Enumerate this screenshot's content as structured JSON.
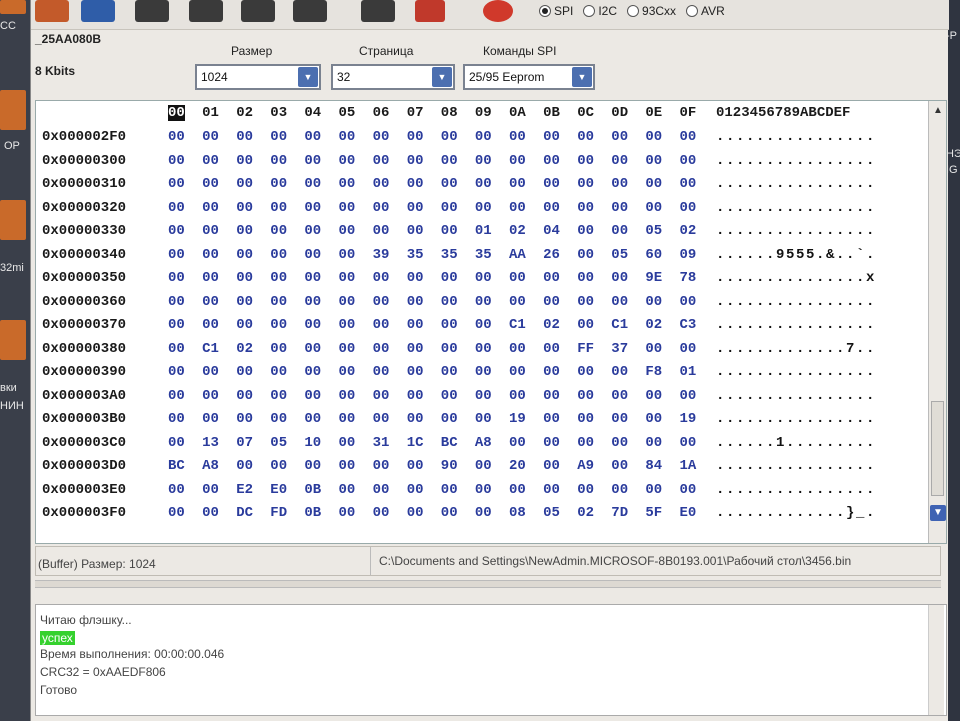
{
  "desktop": {
    "labels": [
      "CC",
      "OP",
      "32mi",
      "вки",
      "НИН"
    ],
    "right_labels": [
      "-P",
      "НЭ",
      "IG"
    ]
  },
  "toolbar": {
    "protocols": [
      "SPI",
      "I2C",
      "93Cxx",
      "AVR"
    ],
    "selected": "SPI"
  },
  "chip": {
    "name": "_25AA080B",
    "size": "8 Kbits"
  },
  "settings": {
    "size_label": "Размер",
    "size_value": "1024",
    "page_label": "Страница",
    "page_value": "32",
    "cmd_label": "Команды SPI",
    "cmd_value": "25/95 Eeprom"
  },
  "hex": {
    "columns": [
      "00",
      "01",
      "02",
      "03",
      "04",
      "05",
      "06",
      "07",
      "08",
      "09",
      "0A",
      "0B",
      "0C",
      "0D",
      "0E",
      "0F"
    ],
    "ascii_header": "0123456789ABCDEF",
    "rows": [
      {
        "addr": "0x000002F0",
        "bytes": [
          "00",
          "00",
          "00",
          "00",
          "00",
          "00",
          "00",
          "00",
          "00",
          "00",
          "00",
          "00",
          "00",
          "00",
          "00",
          "00"
        ],
        "ascii": "................"
      },
      {
        "addr": "0x00000300",
        "bytes": [
          "00",
          "00",
          "00",
          "00",
          "00",
          "00",
          "00",
          "00",
          "00",
          "00",
          "00",
          "00",
          "00",
          "00",
          "00",
          "00"
        ],
        "ascii": "................"
      },
      {
        "addr": "0x00000310",
        "bytes": [
          "00",
          "00",
          "00",
          "00",
          "00",
          "00",
          "00",
          "00",
          "00",
          "00",
          "00",
          "00",
          "00",
          "00",
          "00",
          "00"
        ],
        "ascii": "................"
      },
      {
        "addr": "0x00000320",
        "bytes": [
          "00",
          "00",
          "00",
          "00",
          "00",
          "00",
          "00",
          "00",
          "00",
          "00",
          "00",
          "00",
          "00",
          "00",
          "00",
          "00"
        ],
        "ascii": "................"
      },
      {
        "addr": "0x00000330",
        "bytes": [
          "00",
          "00",
          "00",
          "00",
          "00",
          "00",
          "00",
          "00",
          "00",
          "01",
          "02",
          "04",
          "00",
          "00",
          "05",
          "02"
        ],
        "ascii": "................"
      },
      {
        "addr": "0x00000340",
        "bytes": [
          "00",
          "00",
          "00",
          "00",
          "00",
          "00",
          "39",
          "35",
          "35",
          "35",
          "AA",
          "26",
          "00",
          "05",
          "60",
          "09"
        ],
        "ascii": "......9555.&..`."
      },
      {
        "addr": "0x00000350",
        "bytes": [
          "00",
          "00",
          "00",
          "00",
          "00",
          "00",
          "00",
          "00",
          "00",
          "00",
          "00",
          "00",
          "00",
          "00",
          "9E",
          "78"
        ],
        "ascii": "...............x"
      },
      {
        "addr": "0x00000360",
        "bytes": [
          "00",
          "00",
          "00",
          "00",
          "00",
          "00",
          "00",
          "00",
          "00",
          "00",
          "00",
          "00",
          "00",
          "00",
          "00",
          "00"
        ],
        "ascii": "................"
      },
      {
        "addr": "0x00000370",
        "bytes": [
          "00",
          "00",
          "00",
          "00",
          "00",
          "00",
          "00",
          "00",
          "00",
          "00",
          "C1",
          "02",
          "00",
          "C1",
          "02",
          "C3"
        ],
        "ascii": "................"
      },
      {
        "addr": "0x00000380",
        "bytes": [
          "00",
          "C1",
          "02",
          "00",
          "00",
          "00",
          "00",
          "00",
          "00",
          "00",
          "00",
          "00",
          "FF",
          "37",
          "00",
          "00"
        ],
        "ascii": ".............7.."
      },
      {
        "addr": "0x00000390",
        "bytes": [
          "00",
          "00",
          "00",
          "00",
          "00",
          "00",
          "00",
          "00",
          "00",
          "00",
          "00",
          "00",
          "00",
          "00",
          "F8",
          "01"
        ],
        "ascii": "................"
      },
      {
        "addr": "0x000003A0",
        "bytes": [
          "00",
          "00",
          "00",
          "00",
          "00",
          "00",
          "00",
          "00",
          "00",
          "00",
          "00",
          "00",
          "00",
          "00",
          "00",
          "00"
        ],
        "ascii": "................"
      },
      {
        "addr": "0x000003B0",
        "bytes": [
          "00",
          "00",
          "00",
          "00",
          "00",
          "00",
          "00",
          "00",
          "00",
          "00",
          "19",
          "00",
          "00",
          "00",
          "00",
          "19"
        ],
        "ascii": "................"
      },
      {
        "addr": "0x000003C0",
        "bytes": [
          "00",
          "13",
          "07",
          "05",
          "10",
          "00",
          "31",
          "1C",
          "BC",
          "A8",
          "00",
          "00",
          "00",
          "00",
          "00",
          "00"
        ],
        "ascii": "......1........."
      },
      {
        "addr": "0x000003D0",
        "bytes": [
          "BC",
          "A8",
          "00",
          "00",
          "00",
          "00",
          "00",
          "00",
          "90",
          "00",
          "20",
          "00",
          "A9",
          "00",
          "84",
          "1A"
        ],
        "ascii": "................"
      },
      {
        "addr": "0x000003E0",
        "bytes": [
          "00",
          "00",
          "E2",
          "E0",
          "0B",
          "00",
          "00",
          "00",
          "00",
          "00",
          "00",
          "00",
          "00",
          "00",
          "00",
          "00"
        ],
        "ascii": "................"
      },
      {
        "addr": "0x000003F0",
        "bytes": [
          "00",
          "00",
          "DC",
          "FD",
          "0B",
          "00",
          "00",
          "00",
          "00",
          "00",
          "08",
          "05",
          "02",
          "7D",
          "5F",
          "E0"
        ],
        "ascii": ".............}_."
      }
    ]
  },
  "status": {
    "buffer": "(Buffer) Размер: 1024",
    "path": "C:\\Documents and Settings\\NewAdmin.MICROSOF-8B0193.001\\Рабочий стол\\3456.bin"
  },
  "log": [
    {
      "text": "Читаю флэшку...",
      "ok": false
    },
    {
      "text": "успех",
      "ok": true
    },
    {
      "text": "Время выполнения: 00:00:00.046",
      "ok": false
    },
    {
      "text": "CRC32 = 0xAAEDF806",
      "ok": false
    },
    {
      "text": "Готово",
      "ok": false
    }
  ],
  "colors": {
    "hex_bytes": "#2a3b9c",
    "success": "#35d12e",
    "combo_arrow": "#4c6fb0"
  }
}
